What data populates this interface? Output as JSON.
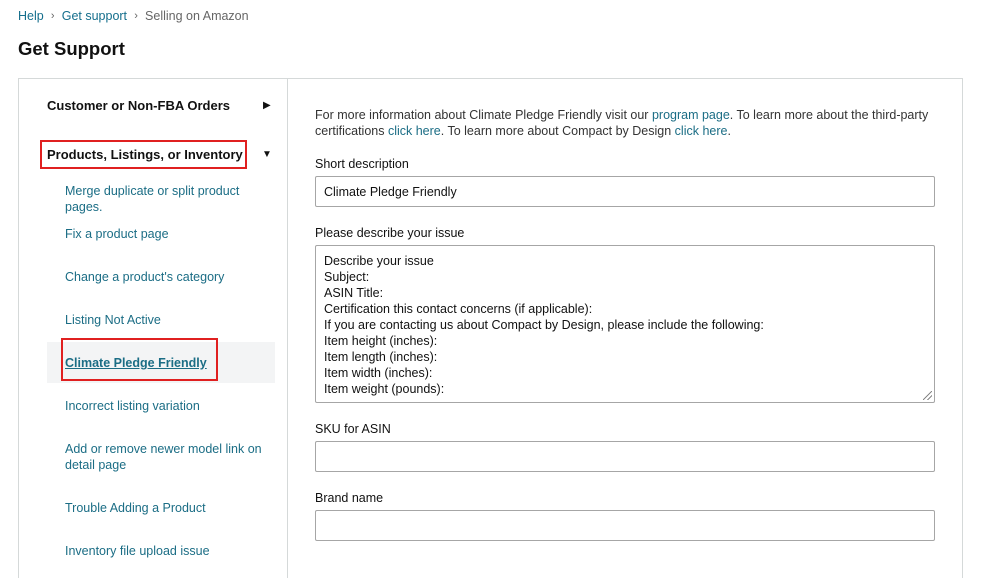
{
  "breadcrumb": {
    "help": "Help",
    "sep": "›",
    "get_support": "Get support",
    "current": "Selling on Amazon"
  },
  "page_title": "Get Support",
  "sidebar": {
    "categories": [
      {
        "label": "Customer or Non-FBA Orders",
        "arrow": "▶"
      },
      {
        "label": "Products, Listings, or Inventory",
        "arrow": "▼"
      }
    ],
    "items": [
      {
        "label": "Merge duplicate or split product pages."
      },
      {
        "label": "Fix a product page"
      },
      {
        "label": "Change a product's category"
      },
      {
        "label": "Listing Not Active"
      },
      {
        "label": "Climate Pledge Friendly"
      },
      {
        "label": "Incorrect listing variation"
      },
      {
        "label": "Add or remove newer model link on detail page"
      },
      {
        "label": "Trouble Adding a Product"
      },
      {
        "label": "Inventory file upload issue"
      }
    ]
  },
  "info": {
    "t1": "For more information about Climate Pledge Friendly visit our ",
    "l1": "program page",
    "t2": ". To learn more about the third-party certifications ",
    "l2": "click here",
    "t3": ". To learn more about Compact by Design ",
    "l3": "click here",
    "t4": "."
  },
  "form": {
    "short_desc_label": "Short description",
    "short_desc_value": "Climate Pledge Friendly",
    "issue_label": "Please describe your issue",
    "issue_lines": [
      "Describe your issue",
      "Subject:",
      "ASIN Title:",
      "Certification this contact concerns (if applicable):",
      "If you are contacting us about Compact by Design, please include the following:",
      "Item height (inches):",
      "Item length (inches):",
      "Item width (inches):",
      "Item weight (pounds):"
    ],
    "sku_label": "SKU for ASIN",
    "sku_value": "",
    "brand_label": "Brand name",
    "brand_value": ""
  }
}
